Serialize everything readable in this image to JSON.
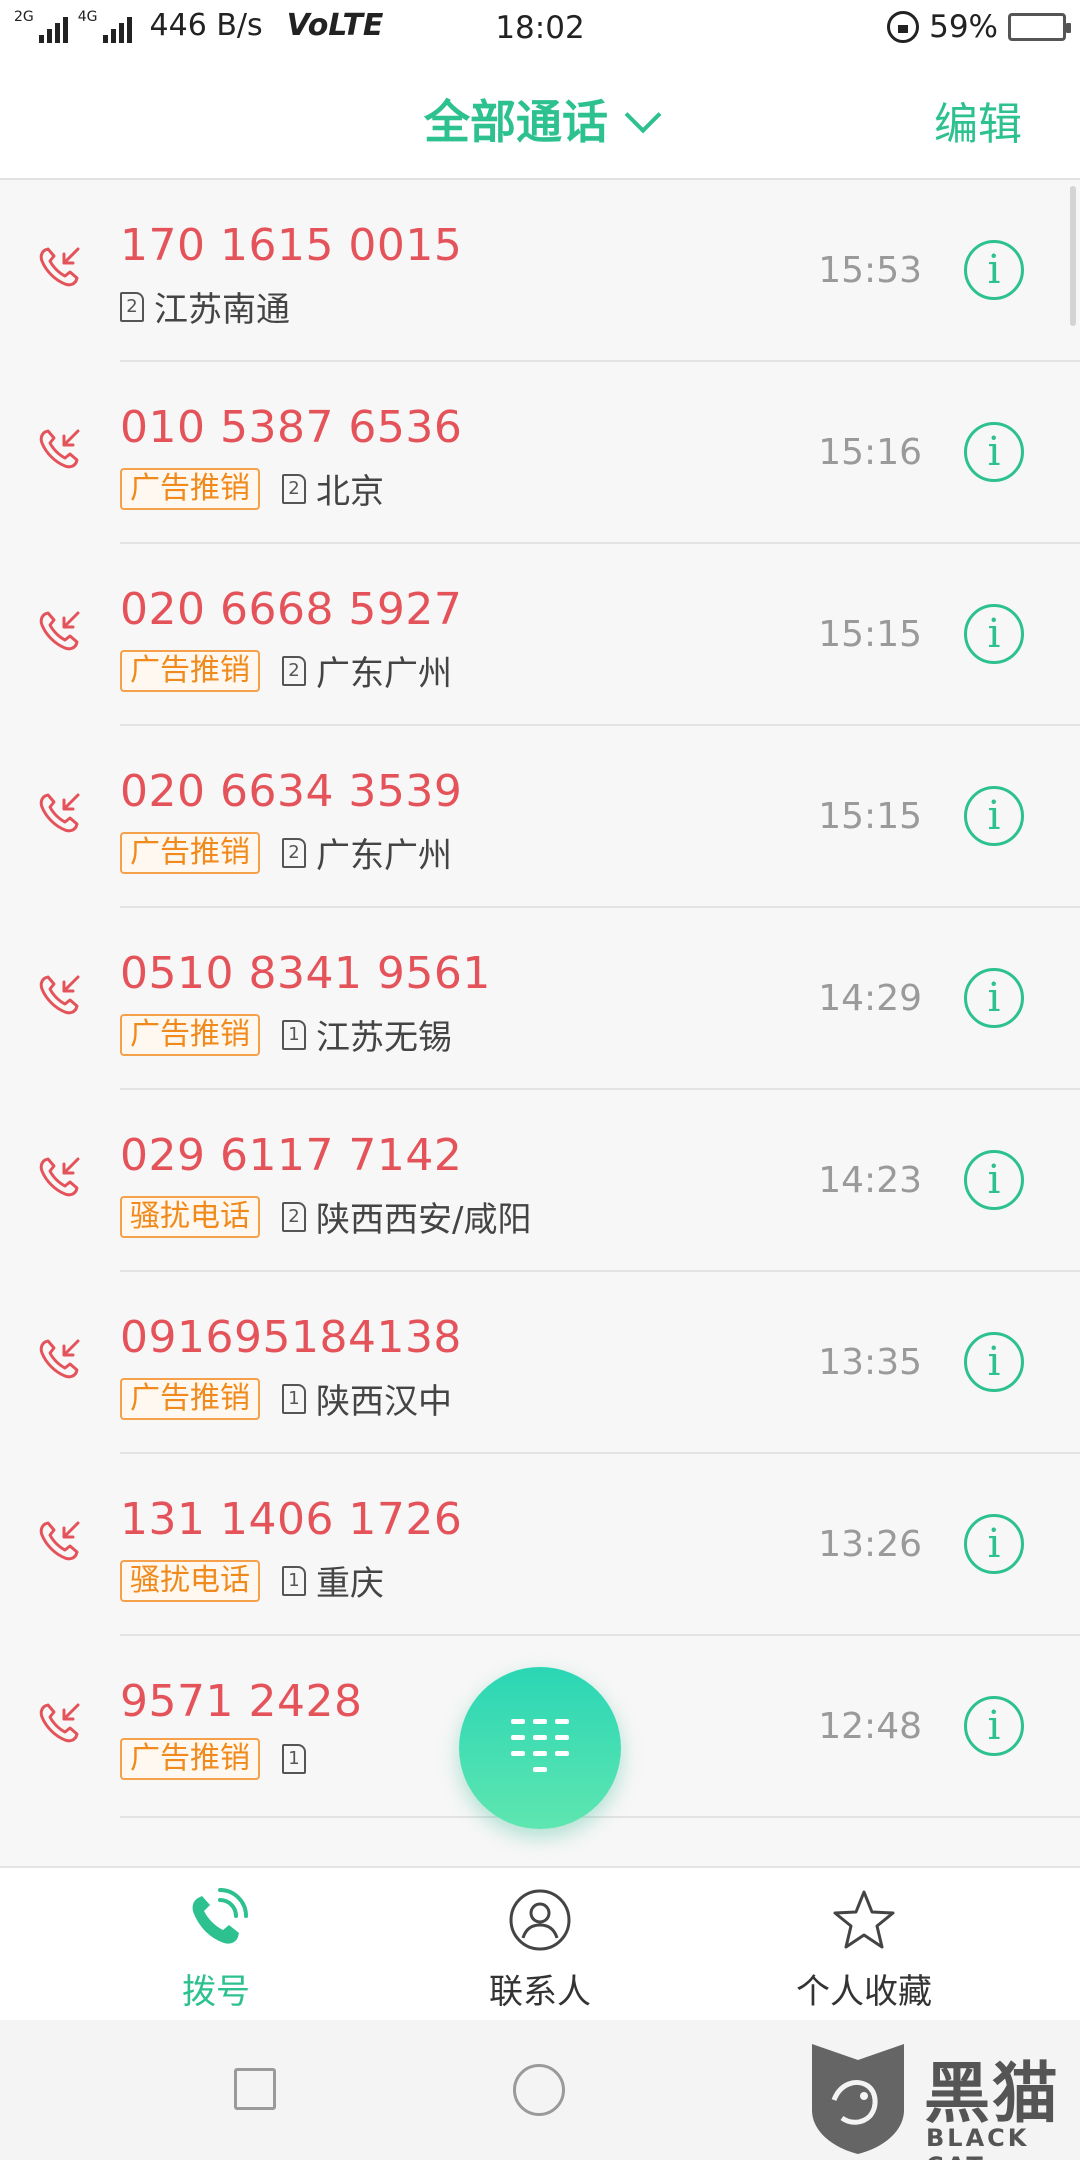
{
  "status_bar": {
    "network_2g": "2G",
    "network_4g": "4G",
    "speed": "446 B/s",
    "volte": "VoLTE",
    "time": "18:02",
    "battery_percent": "59%",
    "battery_level": 0.59,
    "battery_color": "#2aa4f0"
  },
  "header": {
    "title": "全部通话",
    "edit_label": "编辑",
    "accent_color": "#2cc18f"
  },
  "calls": [
    {
      "number": "170 1615 0015",
      "tag": "",
      "sim": "2",
      "location": "江苏南通",
      "time": "15:53"
    },
    {
      "number": "010 5387 6536",
      "tag": "广告推销",
      "sim": "2",
      "location": "北京",
      "time": "15:16"
    },
    {
      "number": "020 6668 5927",
      "tag": "广告推销",
      "sim": "2",
      "location": "广东广州",
      "time": "15:15"
    },
    {
      "number": "020 6634 3539",
      "tag": "广告推销",
      "sim": "2",
      "location": "广东广州",
      "time": "15:15"
    },
    {
      "number": "0510 8341 9561",
      "tag": "广告推销",
      "sim": "1",
      "location": "江苏无锡",
      "time": "14:29"
    },
    {
      "number": "029 6117 7142",
      "tag": "骚扰电话",
      "sim": "2",
      "location": "陕西西安/咸阳",
      "time": "14:23"
    },
    {
      "number": "091695184138",
      "tag": "广告推销",
      "sim": "1",
      "location": "陕西汉中",
      "time": "13:35"
    },
    {
      "number": "131 1406 1726",
      "tag": "骚扰电话",
      "sim": "1",
      "location": "重庆",
      "time": "13:26"
    },
    {
      "number": "9571 2428",
      "tag": "广告推销",
      "sim": "1",
      "location": "",
      "time": "12:48"
    }
  ],
  "info_glyph": "i",
  "call_icon": "missed-call-icon",
  "bottom_nav": {
    "dial_label": "拨号",
    "contacts_label": "联系人",
    "favorites_label": "个人收藏"
  },
  "watermark": {
    "cn": "黑猫",
    "en": "BLACK CAT"
  }
}
